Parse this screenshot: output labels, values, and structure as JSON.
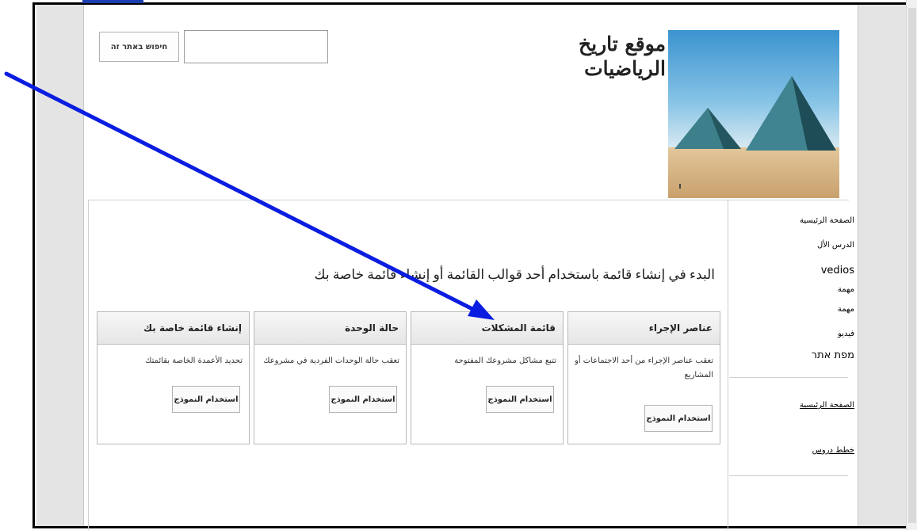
{
  "header": {
    "site_title_line1": "موقع تاريخ",
    "site_title_line2": "الرياضيات",
    "search_button_label": "חיפוש באתר זה",
    "search_placeholder": ""
  },
  "logo": {
    "icon": "pyramids-image"
  },
  "sidebar": {
    "items": [
      {
        "label": "الصفحة الرئيسية"
      },
      {
        "label": "الدرس الأل"
      },
      {
        "label": "vedios"
      },
      {
        "label": "مهمة"
      },
      {
        "label": "مهمة"
      },
      {
        "label": "فيديو"
      },
      {
        "label": "מפת אתר"
      }
    ],
    "bottom_links": [
      {
        "label": "الصفحة الرئيسية"
      },
      {
        "label": "خطط دروس"
      }
    ]
  },
  "main": {
    "intro": "البدء في إنشاء قائمة باستخدام أحد قوالب القائمة أو إنشاء قائمة خاصة بك",
    "cards": [
      {
        "title": "عناصر الإجراء",
        "description": "تعقب عناصر الإجراء من أحد الاجتماعات أو المشاريع",
        "button": "استخدام النموذج"
      },
      {
        "title": "قائمة المشكلات",
        "description": "تتبع مشاكل مشروعك المفتوحة",
        "button": "استخدام النموذج"
      },
      {
        "title": "حالة الوحدة",
        "description": "تعقب حالة الوحدات الفردية في مشروعك",
        "button": "استخدام النموذج"
      },
      {
        "title": "إنشاء قائمة خاصة بك",
        "description": "تحديد الأعمدة الخاصة بقائمتك",
        "button": "استخدام النموذج"
      }
    ]
  },
  "colors": {
    "link": "#1a2d9a",
    "annotation_arrow": "#0a1de0",
    "frame_border": "#000000"
  }
}
